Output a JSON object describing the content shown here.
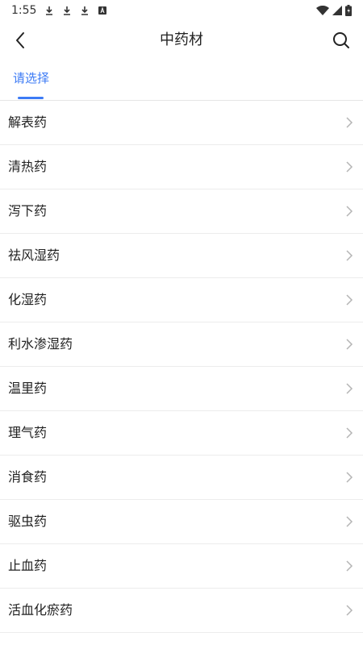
{
  "status_bar": {
    "time": "1:55"
  },
  "header": {
    "title": "中药材"
  },
  "tabs": [
    {
      "label": "请选择",
      "active": true
    }
  ],
  "colors": {
    "accent": "#3d7bf5",
    "divider": "#ececec",
    "chevron": "#b5b5b5"
  },
  "categories": [
    {
      "label": "解表药"
    },
    {
      "label": "清热药"
    },
    {
      "label": "泻下药"
    },
    {
      "label": "祛风湿药"
    },
    {
      "label": "化湿药"
    },
    {
      "label": "利水渗湿药"
    },
    {
      "label": "温里药"
    },
    {
      "label": "理气药"
    },
    {
      "label": "消食药"
    },
    {
      "label": "驱虫药"
    },
    {
      "label": "止血药"
    },
    {
      "label": "活血化瘀药"
    }
  ]
}
